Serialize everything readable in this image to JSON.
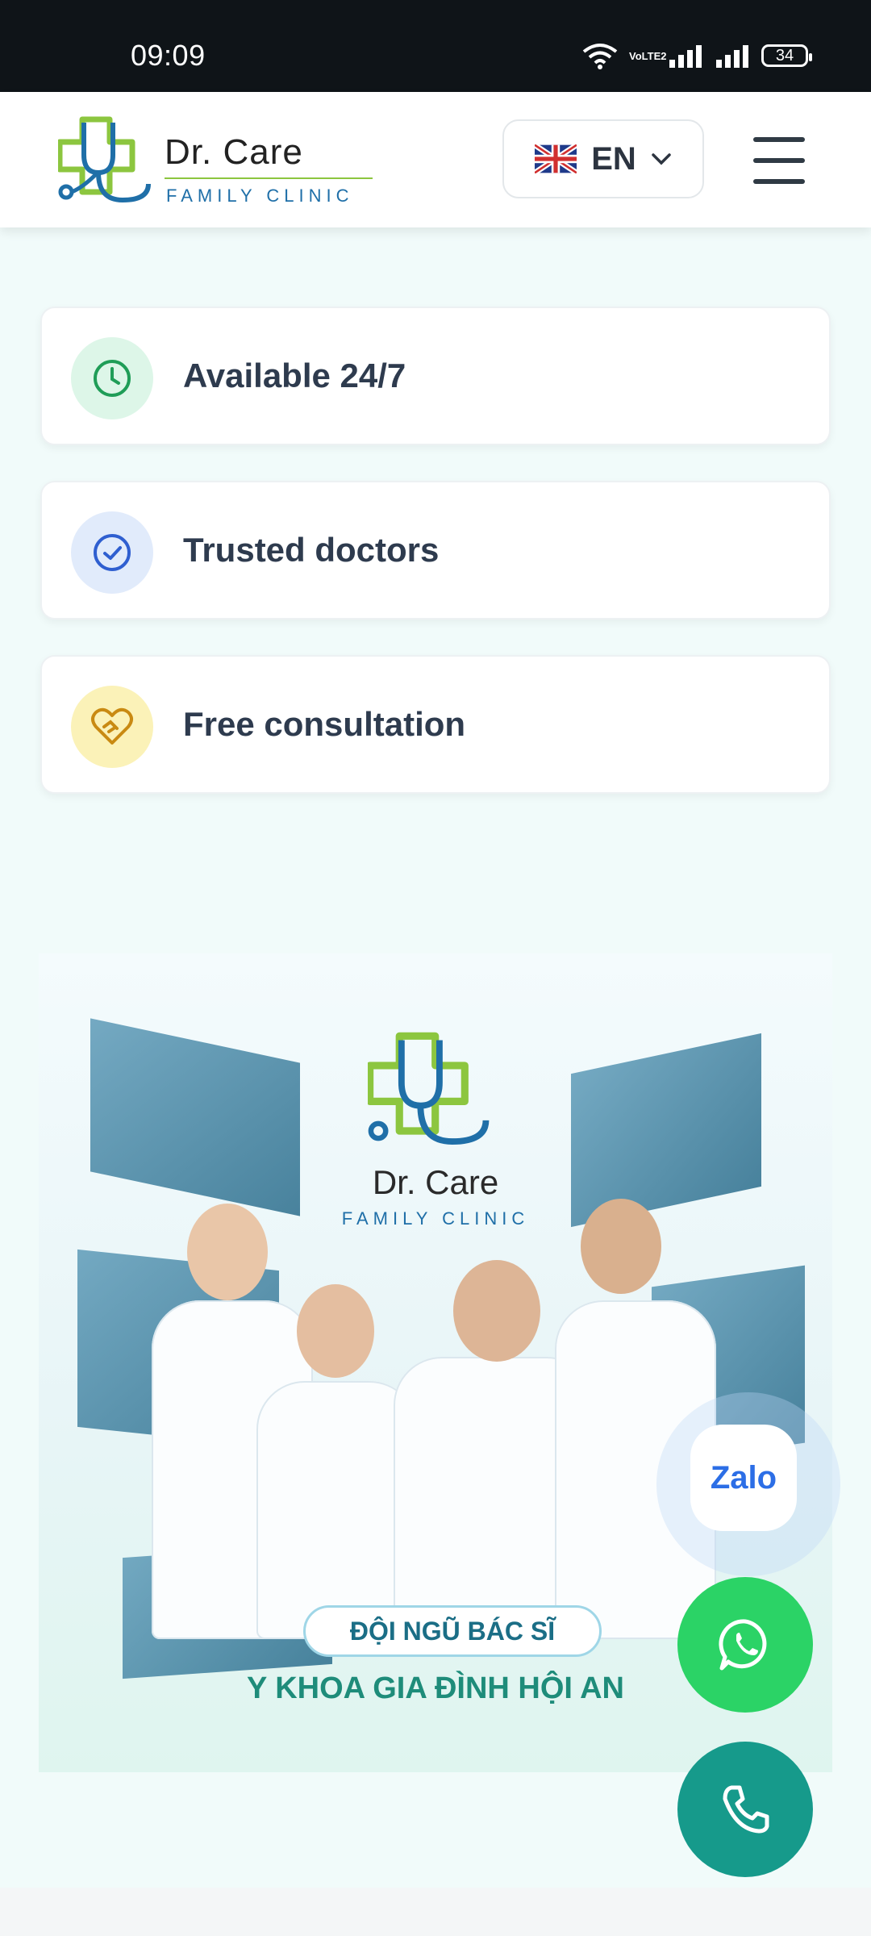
{
  "status_bar": {
    "time": "09:09",
    "network_label": "VoLTE2",
    "battery": "34"
  },
  "header": {
    "brand_name": "Dr. Care",
    "brand_sub": "FAMILY CLINIC",
    "language": "EN",
    "flag": "uk-flag-icon",
    "menu_icon": "hamburger-icon"
  },
  "features": [
    {
      "label": "Available 24/7",
      "icon": "clock-icon",
      "color": "#1f9d57",
      "bg": "#ddf6e8"
    },
    {
      "label": "Trusted doctors",
      "icon": "check-circle-icon",
      "color": "#2f5fd0",
      "bg": "#e1ebfb"
    },
    {
      "label": "Free consultation",
      "icon": "heart-handshake-icon",
      "color": "#c98a12",
      "bg": "#fbf2b8"
    }
  ],
  "banner": {
    "logo_name": "Dr. Care",
    "logo_sub": "FAMILY CLINIC",
    "title": "ĐỘI NGŨ BÁC SĨ",
    "subtitle": "Y KHOA GIA ĐÌNH HỘI AN"
  },
  "floating": {
    "zalo_label": "Zalo",
    "whatsapp_icon": "whatsapp-icon",
    "phone_icon": "phone-icon"
  },
  "colors": {
    "accent_green": "#8cc63f",
    "brand_blue": "#1f6fa8",
    "whatsapp": "#2bd366",
    "phone": "#169a8b"
  }
}
